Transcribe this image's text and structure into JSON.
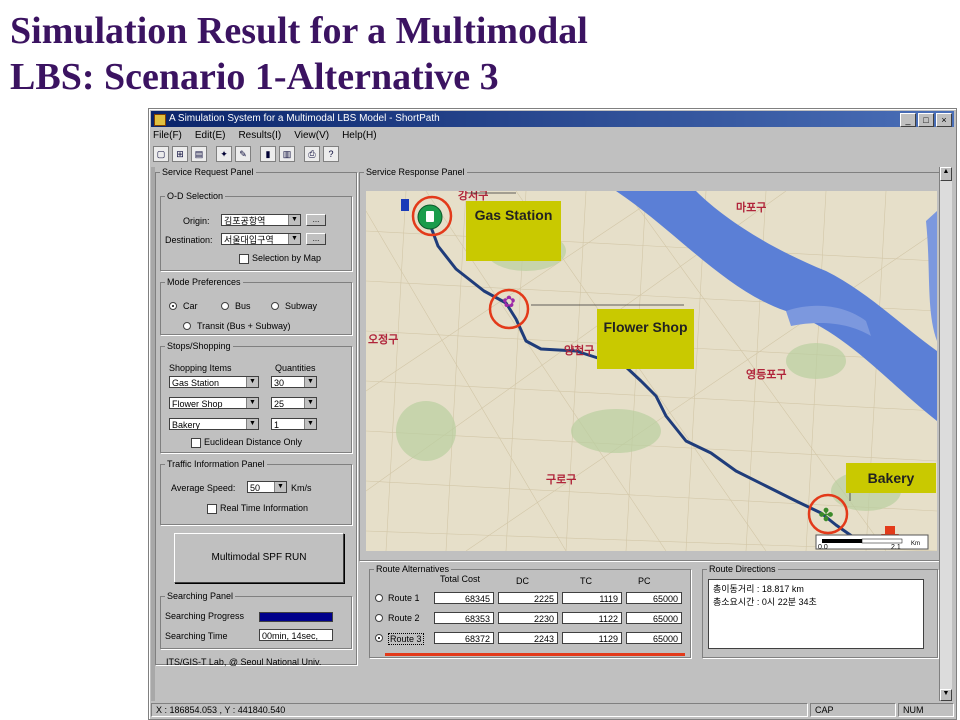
{
  "slide": {
    "title_line1": "Simulation Result for a Multimodal",
    "title_line2": "LBS: Scenario 1-Alternative 3"
  },
  "window": {
    "title": "A Simulation System for a Multimodal LBS Model - ShortPath",
    "controls": [
      "_",
      "□",
      "×"
    ]
  },
  "menu": [
    "File(F)",
    "Edit(E)",
    "Results(I)",
    "View(V)",
    "Help(H)"
  ],
  "request_panel": {
    "title": "Service Request Panel",
    "od": {
      "title": "O-D Selection",
      "origin_label": "Origin:",
      "origin_value": "김포공항역",
      "destination_label": "Destination:",
      "destination_value": "서울대입구역",
      "browse": "...",
      "selection_by_map": "Selection by Map"
    },
    "mode": {
      "title": "Mode Preferences",
      "car": "Car",
      "bus": "Bus",
      "subway": "Subway",
      "transit": "Transit (Bus + Subway)",
      "selected": "Car"
    },
    "stops": {
      "title": "Stops/Shopping",
      "items_header": "Shopping Items",
      "quantities_header": "Quantities",
      "rows": [
        {
          "item": "Gas Station",
          "qty": "30"
        },
        {
          "item": "Flower Shop",
          "qty": "25"
        },
        {
          "item": "Bakery",
          "qty": "1"
        }
      ],
      "euclidean": "Euclidean Distance Only"
    },
    "traffic": {
      "title": "Traffic Information Panel",
      "speed_label": "Average Speed:",
      "speed_value": "50",
      "speed_unit": "Km/s",
      "realtime": "Real Time Information"
    },
    "run_button": "Multimodal SPF RUN",
    "searching": {
      "title": "Searching Panel",
      "progress_label": "Searching Progress",
      "progress": 1.0,
      "time_label": "Searching Time",
      "time_value": "00min, 14sec,"
    },
    "credit": "ITS/GIS-T Lab, @ Seoul National Univ."
  },
  "response_panel": {
    "title": "Service Response Panel",
    "callouts": {
      "gas": "Gas Station",
      "flower": "Flower Shop",
      "bakery": "Bakery"
    },
    "map_labels": [
      "강서구",
      "마포구",
      "오정구",
      "양천구",
      "영등포구",
      "구로구"
    ],
    "scale": {
      "start": "0.0",
      "end": "2.1",
      "unit": "Km"
    }
  },
  "route_alternatives": {
    "title": "Route Alternatives",
    "headers": [
      "Total Cost",
      "DC",
      "TC",
      "PC"
    ],
    "selected": 2,
    "rows": [
      {
        "label": "Route 1",
        "values": [
          "68345",
          "2225",
          "1119",
          "65000"
        ]
      },
      {
        "label": "Route 2",
        "values": [
          "68353",
          "2230",
          "1122",
          "65000"
        ]
      },
      {
        "label": "Route 3",
        "values": [
          "68372",
          "2243",
          "1129",
          "65000"
        ]
      }
    ]
  },
  "route_directions": {
    "title": "Route Directions",
    "line1": "총이동거리 : 18.817 km",
    "line2": "총소요시간 : 0시 22분 34초"
  },
  "status": {
    "coords": "X : 186854.053 ,   Y : 441840.540",
    "cap": "CAP",
    "num": "NUM"
  }
}
